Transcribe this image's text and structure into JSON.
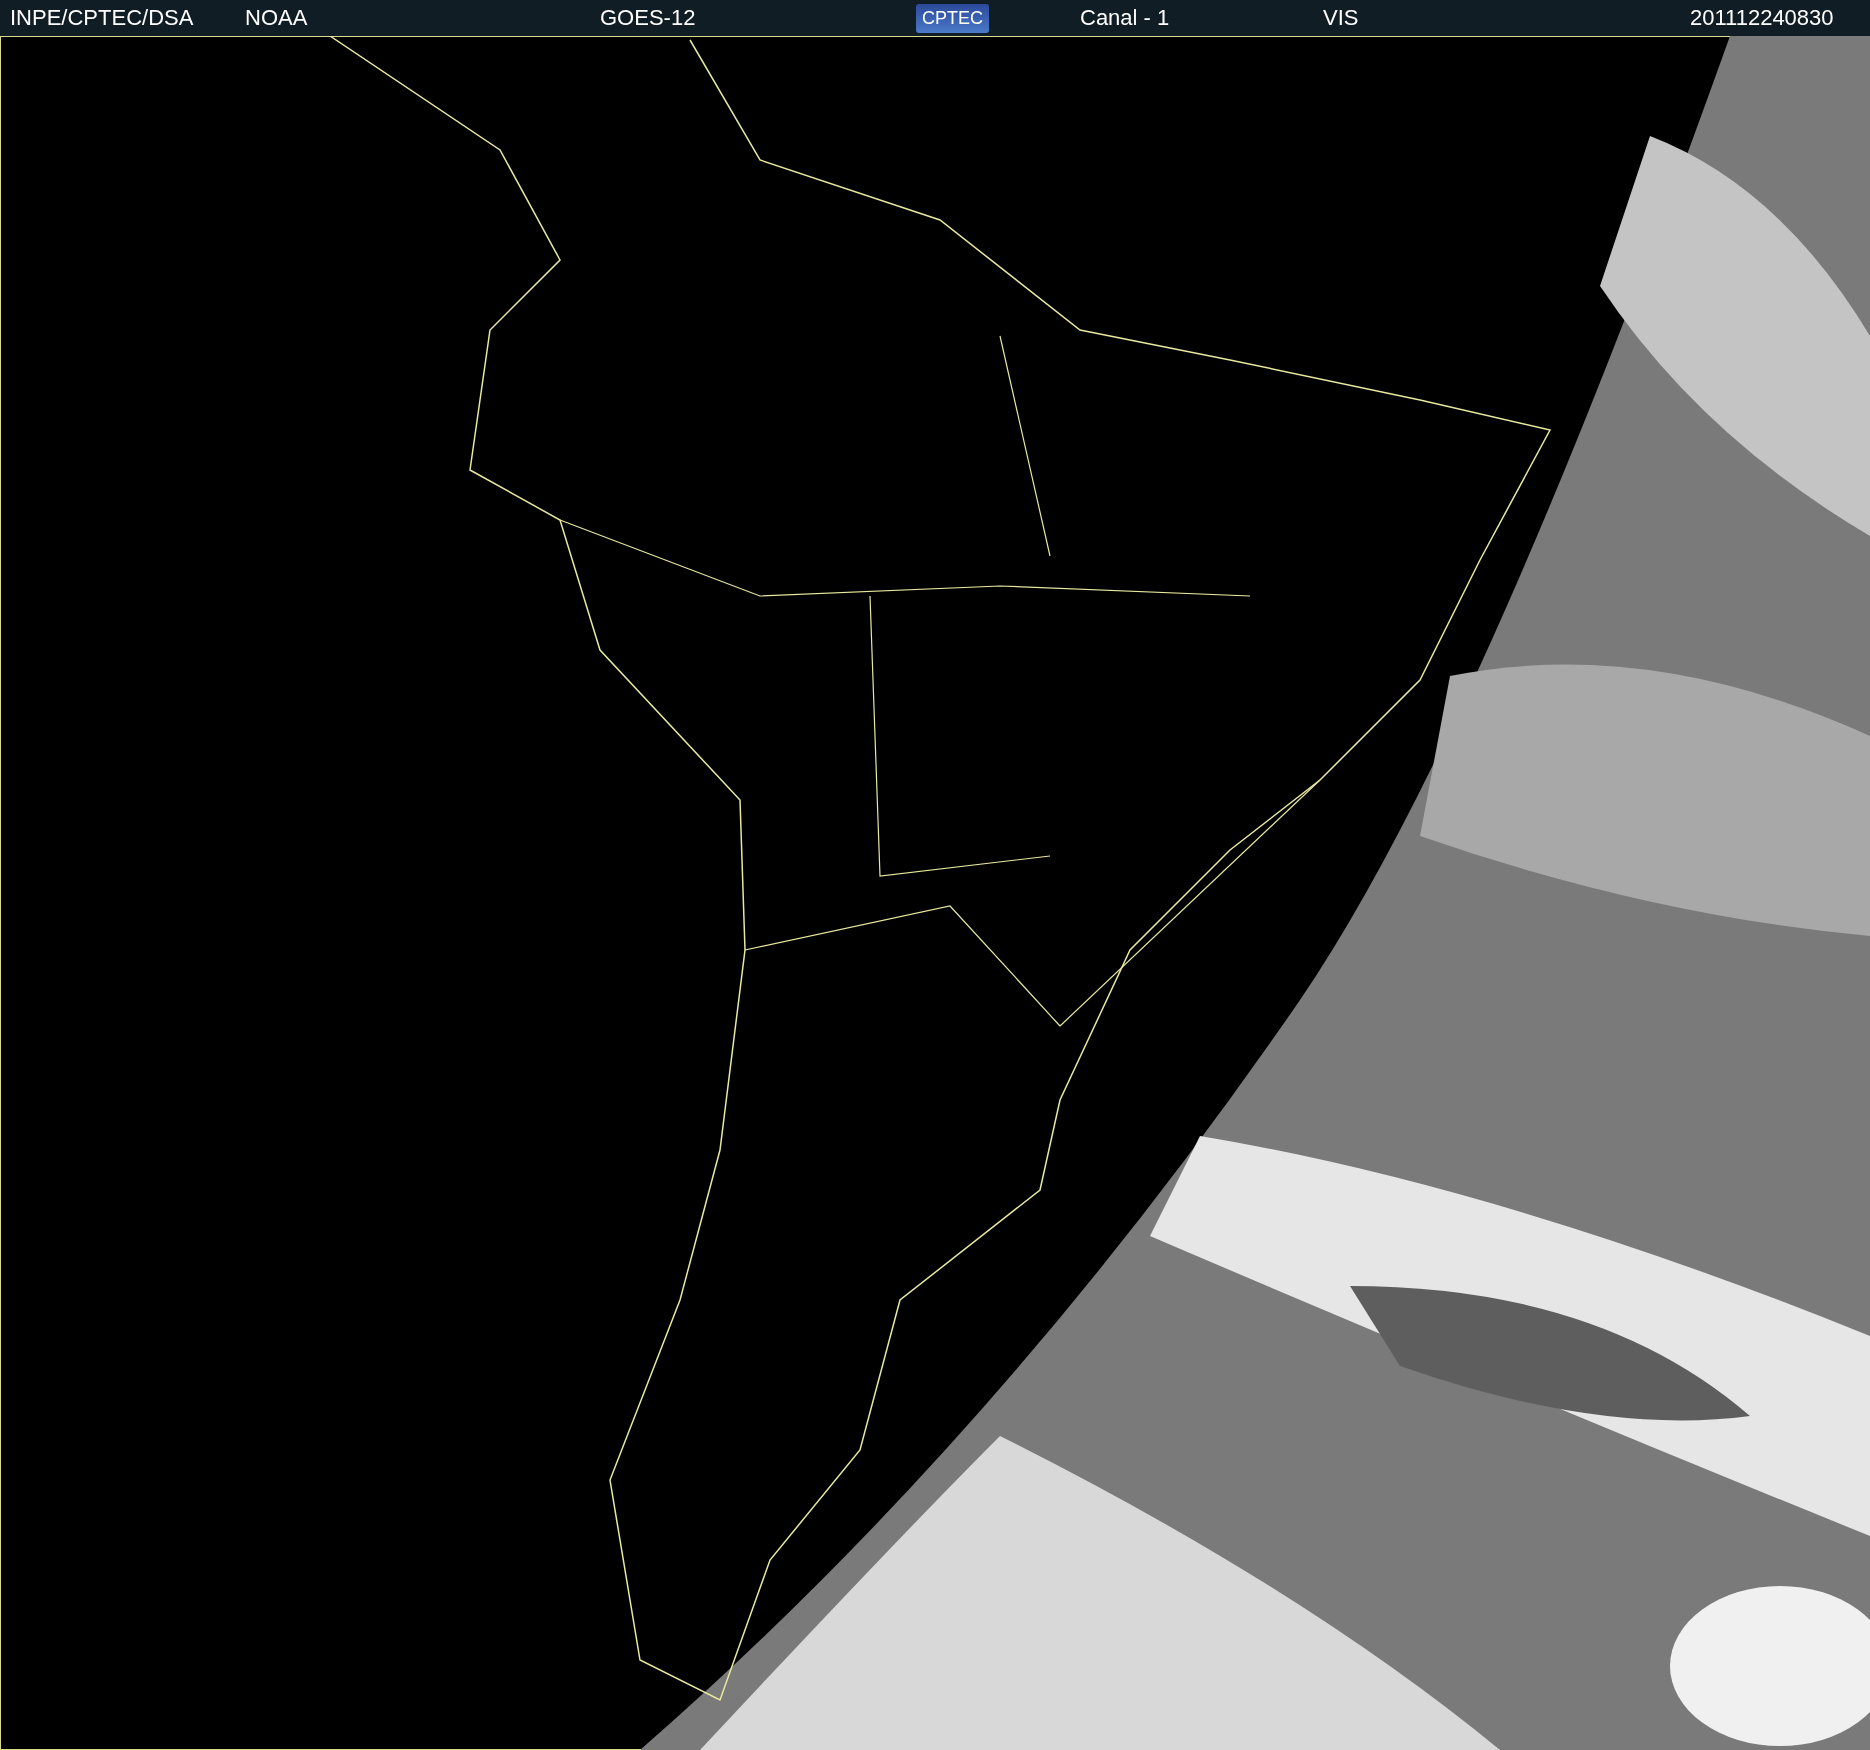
{
  "header": {
    "labels": [
      {
        "kind": "text",
        "text": "INPE/CPTEC/DSA"
      },
      {
        "kind": "text",
        "text": "NOAA"
      },
      {
        "kind": "text",
        "text": "GOES-12"
      },
      {
        "kind": "logo",
        "text": "CPTEC"
      },
      {
        "kind": "text",
        "text": "Canal - 1"
      },
      {
        "kind": "text",
        "text": "VIS"
      },
      {
        "kind": "text",
        "text": "201112240830"
      }
    ]
  }
}
